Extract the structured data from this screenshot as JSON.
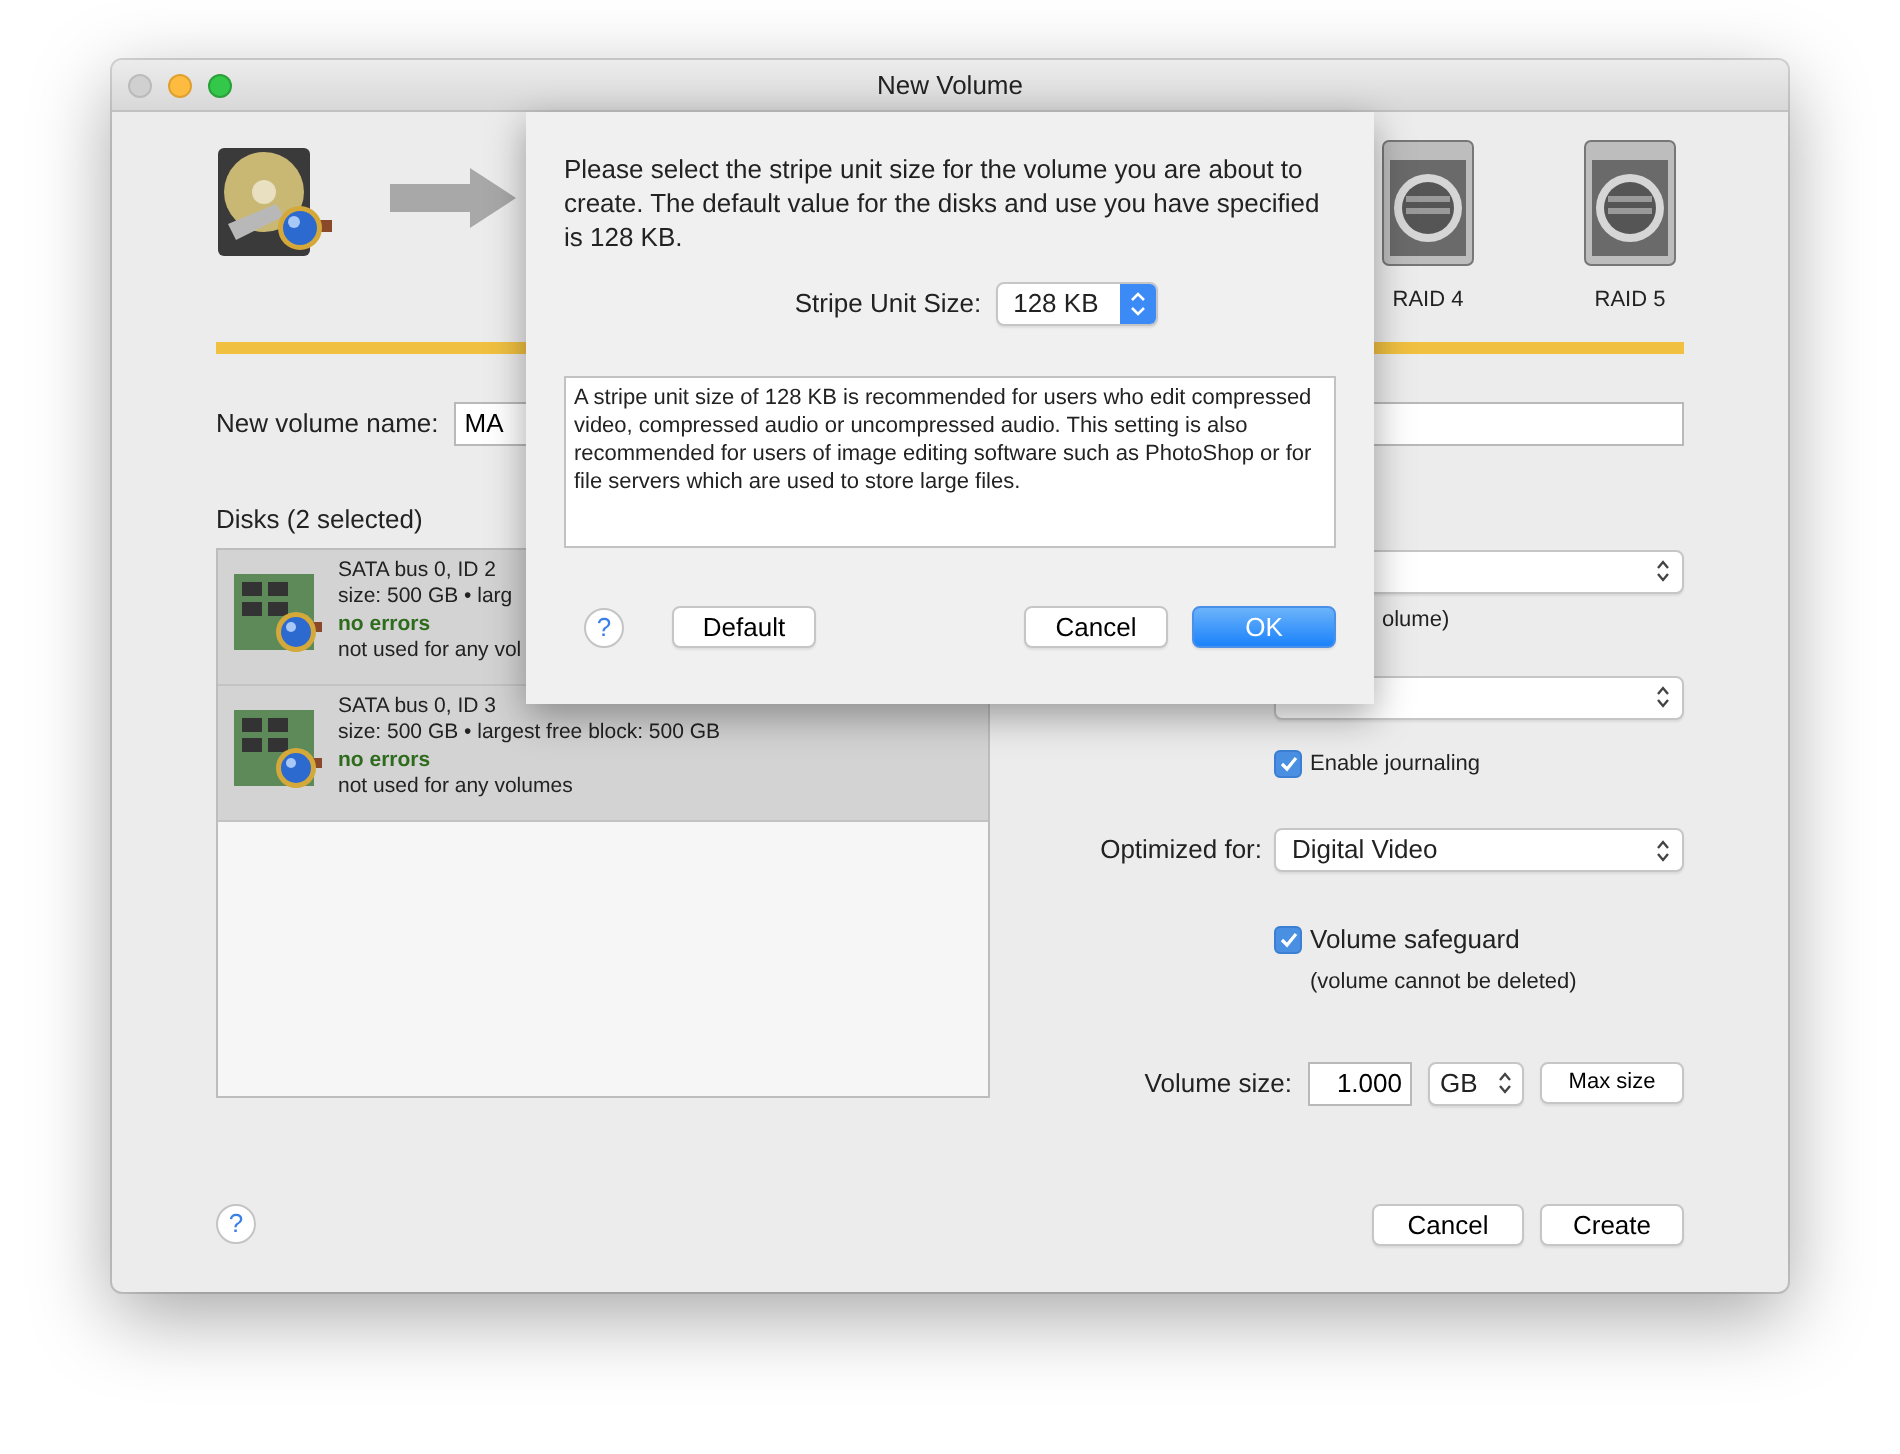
{
  "window": {
    "title": "New Volume"
  },
  "raid_levels": [
    {
      "label": "RAID 4"
    },
    {
      "label": "RAID 5"
    }
  ],
  "volume_name": {
    "label": "New volume name:",
    "value": "MA"
  },
  "disks": {
    "heading": "Disks (2 selected)",
    "items": [
      {
        "name": "SATA bus 0, ID 2",
        "details": "size: 500 GB • larg",
        "status": "no errors",
        "usage": "not used for any vol",
        "selected": true
      },
      {
        "name": "SATA bus 0, ID 3",
        "details": "size: 500 GB • largest free block: 500 GB",
        "status": "no errors",
        "usage": "not used for any volumes",
        "selected": true
      }
    ]
  },
  "options": {
    "format_note": "olume)",
    "journaling": {
      "label": "Enable journaling",
      "checked": true
    },
    "optimized_for": {
      "label": "Optimized for:",
      "value": "Digital Video"
    },
    "safeguard": {
      "label": "Volume safeguard",
      "checked": true,
      "note": "(volume cannot be deleted)"
    },
    "volume_size": {
      "label": "Volume size:",
      "value": "1.000",
      "unit": "GB",
      "button": "Max size"
    }
  },
  "help_button": "?",
  "buttons": [
    {
      "label": "Cancel",
      "default": false
    },
    {
      "label": "Create",
      "default": false
    }
  ],
  "sheet": {
    "message": "Please select the stripe unit size for the volume you are about to create.  The default value for the disks and use you have specified is 128 KB.",
    "stripe": {
      "label": "Stripe Unit Size:",
      "value": "128 KB"
    },
    "help_button": "?",
    "description": "A stripe unit size of 128 KB is recommended for users who edit compressed video, compressed audio or uncompressed audio.  This setting is also recommended for users of image editing software such as PhotoShop or for file servers which are used to store large files.",
    "buttons": [
      {
        "label": "Default",
        "default": false
      },
      {
        "label": "Cancel",
        "default": false
      },
      {
        "label": "OK",
        "default": true
      }
    ]
  }
}
